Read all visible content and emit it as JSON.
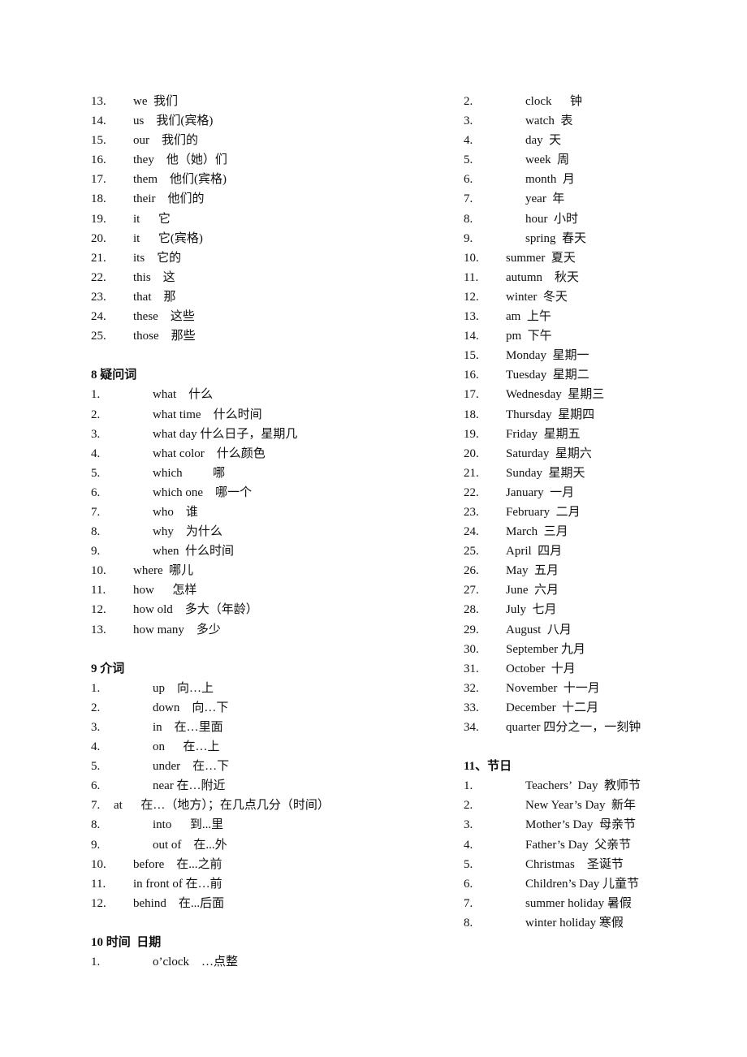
{
  "left_column": {
    "pronouns": [
      {
        "num": "13.",
        "text": "we  我们"
      },
      {
        "num": "14.",
        "text": "us    我们(宾格)"
      },
      {
        "num": "15.",
        "text": "our    我们的"
      },
      {
        "num": "16.",
        "text": "they    他（她）们"
      },
      {
        "num": "17.",
        "text": "them    他们(宾格)"
      },
      {
        "num": "18.",
        "text": "their    他们的"
      },
      {
        "num": "19.",
        "text": "it      它"
      },
      {
        "num": "20.",
        "text": "it      它(宾格)"
      },
      {
        "num": "21.",
        "text": "its    它的"
      },
      {
        "num": "22.",
        "text": "this    这"
      },
      {
        "num": "23.",
        "text": "that    那"
      },
      {
        "num": "24.",
        "text": "these    这些"
      },
      {
        "num": "25.",
        "text": "those    那些"
      }
    ],
    "section8": {
      "heading": "8 疑问词",
      "items": [
        {
          "num": "1.",
          "text": "what    什么"
        },
        {
          "num": "2.",
          "text": "what time    什么时间"
        },
        {
          "num": "3.",
          "text": "what day 什么日子，星期几"
        },
        {
          "num": "4.",
          "text": "what color    什么颜色"
        },
        {
          "num": "5.",
          "text": "which          哪"
        },
        {
          "num": "6.",
          "text": "which one    哪一个"
        },
        {
          "num": "7.",
          "text": "who    谁"
        },
        {
          "num": "8.",
          "text": "why    为什么"
        },
        {
          "num": "9.",
          "text": "when  什么时间"
        },
        {
          "num": "10.",
          "text": "where  哪儿"
        },
        {
          "num": "11.",
          "text": "how      怎样"
        },
        {
          "num": "12.",
          "text": "how old    多大（年龄）"
        },
        {
          "num": "13.",
          "text": "how many    多少"
        }
      ]
    },
    "section9": {
      "heading": "9 介词",
      "items": [
        {
          "num": "1.",
          "text": "up    向…上"
        },
        {
          "num": "2.",
          "text": "down    向…下"
        },
        {
          "num": "3.",
          "text": "in    在…里面"
        },
        {
          "num": "4.",
          "text": "on      在…上"
        },
        {
          "num": "5.",
          "text": "under    在…下"
        },
        {
          "num": "6.",
          "text": "near 在…附近"
        },
        {
          "num": "7.",
          "text": "at      在…（地方）；在几点几分（时间）"
        },
        {
          "num": "8.",
          "text": "into      到...里"
        },
        {
          "num": "9.",
          "text": "out of    在...外"
        },
        {
          "num": "10.",
          "text": "before    在...之前"
        },
        {
          "num": "11.",
          "text": "in front of 在…前"
        },
        {
          "num": "12.",
          "text": "behind    在...后面"
        }
      ]
    },
    "section10": {
      "heading": "10 时间  日期",
      "items": [
        {
          "num": "1.",
          "text": "o’clock    …点整"
        }
      ]
    }
  },
  "right_column": {
    "time_items": [
      {
        "num": "2.",
        "text": "clock      钟"
      },
      {
        "num": "3.",
        "text": "watch  表"
      },
      {
        "num": "4.",
        "text": "day  天"
      },
      {
        "num": "5.",
        "text": "week  周"
      },
      {
        "num": "6.",
        "text": "month  月"
      },
      {
        "num": "7.",
        "text": "year  年"
      },
      {
        "num": "8.",
        "text": "hour  小时"
      },
      {
        "num": "9.",
        "text": "spring  春天"
      },
      {
        "num": "10.",
        "text": "summer  夏天"
      },
      {
        "num": "11.",
        "text": "autumn    秋天"
      },
      {
        "num": "12.",
        "text": "winter  冬天"
      },
      {
        "num": "13.",
        "text": "am  上午"
      },
      {
        "num": "14.",
        "text": "pm  下午"
      },
      {
        "num": "15.",
        "text": "Monday  星期一"
      },
      {
        "num": "16.",
        "text": "Tuesday  星期二"
      },
      {
        "num": "17.",
        "text": "Wednesday  星期三"
      },
      {
        "num": "18.",
        "text": "Thursday  星期四"
      },
      {
        "num": "19.",
        "text": "Friday  星期五"
      },
      {
        "num": "20.",
        "text": "Saturday  星期六"
      },
      {
        "num": "21.",
        "text": "Sunday  星期天"
      },
      {
        "num": "22.",
        "text": "January  一月"
      },
      {
        "num": "23.",
        "text": "February  二月"
      },
      {
        "num": "24.",
        "text": "March  三月"
      },
      {
        "num": "25.",
        "text": "April  四月"
      },
      {
        "num": "26.",
        "text": "May  五月"
      },
      {
        "num": "27.",
        "text": "June  六月"
      },
      {
        "num": "28.",
        "text": "July  七月"
      },
      {
        "num": "29.",
        "text": "August  八月"
      },
      {
        "num": "30.",
        "text": "September 九月"
      },
      {
        "num": "31.",
        "text": "October  十月"
      },
      {
        "num": "32.",
        "text": "November  十一月"
      },
      {
        "num": "33.",
        "text": "December  十二月"
      },
      {
        "num": "34.",
        "text": "quarter 四分之一，一刻钟"
      }
    ],
    "section11": {
      "heading": "11、节日",
      "items": [
        {
          "num": "1.",
          "text": "Teachers’  Day  教师节"
        },
        {
          "num": "2.",
          "text": "New Year’s Day  新年"
        },
        {
          "num": "3.",
          "text": "Mother’s Day  母亲节"
        },
        {
          "num": "4.",
          "text": "Father’s Day  父亲节"
        },
        {
          "num": "5.",
          "text": "Christmas    圣诞节"
        },
        {
          "num": "6.",
          "text": "Children’s Day 儿童节"
        },
        {
          "num": "7.",
          "text": "summer holiday 暑假"
        },
        {
          "num": "8.",
          "text": "winter holiday 寒假"
        }
      ]
    }
  }
}
